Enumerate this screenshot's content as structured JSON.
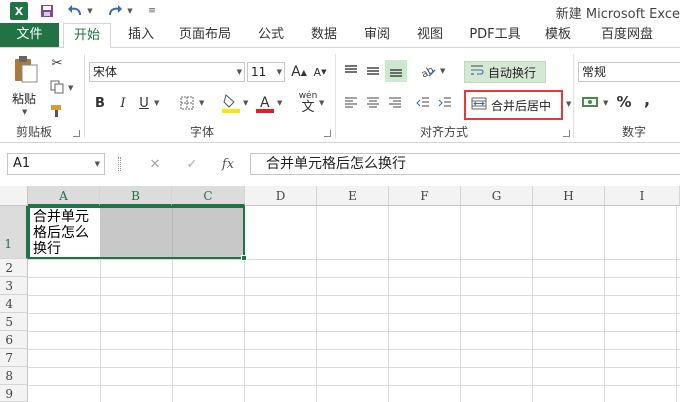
{
  "window": {
    "title": "新建 Microsoft Exce"
  },
  "quick_access": {
    "app_icon": "X",
    "icons": [
      "excel-logo-icon",
      "save-icon",
      "undo-icon",
      "redo-icon",
      "customize-icon"
    ]
  },
  "tabs": [
    {
      "label": "文件"
    },
    {
      "label": "开始"
    },
    {
      "label": "插入"
    },
    {
      "label": "页面布局"
    },
    {
      "label": "公式"
    },
    {
      "label": "数据"
    },
    {
      "label": "审阅"
    },
    {
      "label": "视图"
    },
    {
      "label": "PDF工具"
    },
    {
      "label": "模板"
    },
    {
      "label": "百度网盘"
    }
  ],
  "ribbon": {
    "clipboard": {
      "label": "剪贴板",
      "paste": "粘贴"
    },
    "font": {
      "label": "字体",
      "name": "宋体",
      "size": "11",
      "bold": "B",
      "italic": "I",
      "underline": "U",
      "grow": "A",
      "shrink": "A",
      "wen": "wén",
      "wen_char": "文"
    },
    "alignment": {
      "label": "对齐方式",
      "wrap_text": "自动换行",
      "merge_center": "合并后居中"
    },
    "number": {
      "label": "数字",
      "format": "常规",
      "percent": "%",
      "comma": ","
    }
  },
  "formula_bar": {
    "name_box": "A1",
    "fx": "fx",
    "cancel": "✕",
    "enter": "✓",
    "content": "合并单元格后怎么换行"
  },
  "sheet": {
    "columns": [
      "A",
      "B",
      "C",
      "D",
      "E",
      "F",
      "G",
      "H",
      "I"
    ],
    "rows": [
      "1",
      "2",
      "3",
      "4",
      "5",
      "6",
      "7",
      "8",
      "9"
    ],
    "active_cell_text": "合并单元格后怎么换行"
  },
  "colors": {
    "accent": "#217346",
    "highlight_red": "#e03a3a",
    "selection_gray": "#c8c8c8"
  }
}
